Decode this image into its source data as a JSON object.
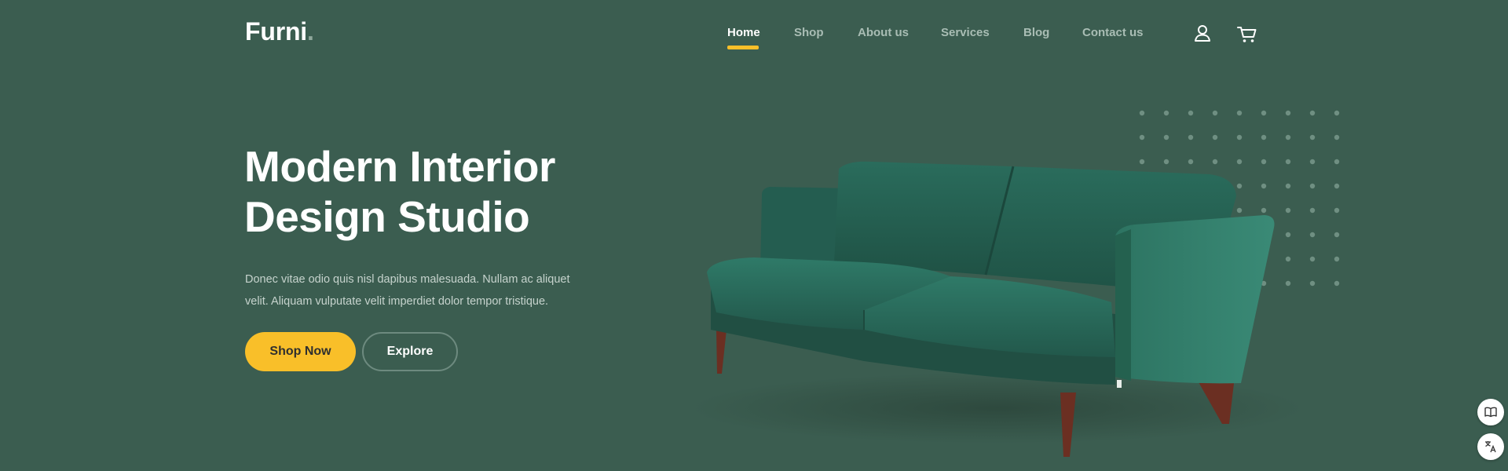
{
  "brand": {
    "name": "Furni",
    "dot": "."
  },
  "nav": {
    "items": [
      {
        "label": "Home",
        "active": true
      },
      {
        "label": "Shop"
      },
      {
        "label": "About us"
      },
      {
        "label": "Services"
      },
      {
        "label": "Blog"
      },
      {
        "label": "Contact us"
      }
    ],
    "icons": [
      "user-icon",
      "cart-icon"
    ]
  },
  "hero": {
    "title_line1": "Modern Interior",
    "title_line2": "Design Studio",
    "text": "Donec vitae odio quis nisl dapibus malesuada. Nullam ac aliquet velit. Aliquam vulputate velit imperdiet dolor tempor tristique.",
    "primary_button": "Shop Now",
    "secondary_button": "Explore"
  },
  "side_buttons": [
    "book-icon",
    "translate-icon"
  ],
  "colors": {
    "background": "#3b5d50",
    "accent": "#f9bf29",
    "nav_inactive": "#a9bdb4",
    "sofa": "#2b6b5c"
  }
}
